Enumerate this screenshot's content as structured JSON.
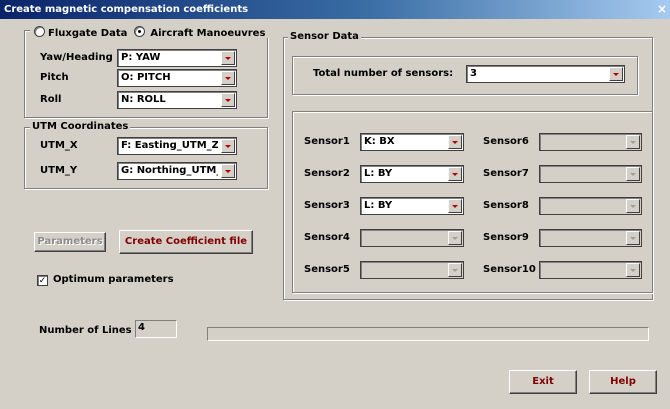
{
  "window": {
    "title": "Create magnetic compensation coefficients",
    "close_glyph": "×"
  },
  "mode": {
    "option_fluxgate": "Fluxgate Data",
    "option_aircraft": "Aircraft Manoeuvres",
    "selected": "Aircraft Manoeuvres"
  },
  "attitude": {
    "yaw_label": "Yaw/Heading",
    "yaw_value": "P: YAW",
    "pitch_label": "Pitch",
    "pitch_value": "O: PITCH",
    "roll_label": "Roll",
    "roll_value": "N: ROLL"
  },
  "utm": {
    "title": "UTM Coordinates",
    "x_label": "UTM_X",
    "x_value": "F: Easting_UTM_Zn",
    "y_label": "UTM_Y",
    "y_value": "G: Northing_UTM_Z"
  },
  "buttons": {
    "parameters": "Parameters",
    "create_coeff": "Create Coefficient file",
    "exit": "Exit",
    "help": "Help"
  },
  "optimum": {
    "label": "Optimum parameters",
    "checked": true,
    "mark": "✓"
  },
  "lines": {
    "label": "Number of Lines",
    "value": "4",
    "progress": 0
  },
  "sensor_data": {
    "title": "Sensor Data",
    "total_label": "Total number of sensors:",
    "total_value": "3",
    "sensors": [
      {
        "label": "Sensor1",
        "value": "K: BX",
        "enabled": true
      },
      {
        "label": "Sensor2",
        "value": "L: BY",
        "enabled": true
      },
      {
        "label": "Sensor3",
        "value": "L: BY",
        "enabled": true
      },
      {
        "label": "Sensor4",
        "value": "",
        "enabled": false
      },
      {
        "label": "Sensor5",
        "value": "",
        "enabled": false
      },
      {
        "label": "Sensor6",
        "value": "",
        "enabled": false
      },
      {
        "label": "Sensor7",
        "value": "",
        "enabled": false
      },
      {
        "label": "Sensor8",
        "value": "",
        "enabled": false
      },
      {
        "label": "Sensor9",
        "value": "",
        "enabled": false
      },
      {
        "label": "Sensor10",
        "value": "",
        "enabled": false
      }
    ]
  },
  "colors": {
    "title_start": "#0a246a",
    "title_end": "#a6caf0",
    "button_text": "#800000",
    "arrow": "#b00000"
  }
}
